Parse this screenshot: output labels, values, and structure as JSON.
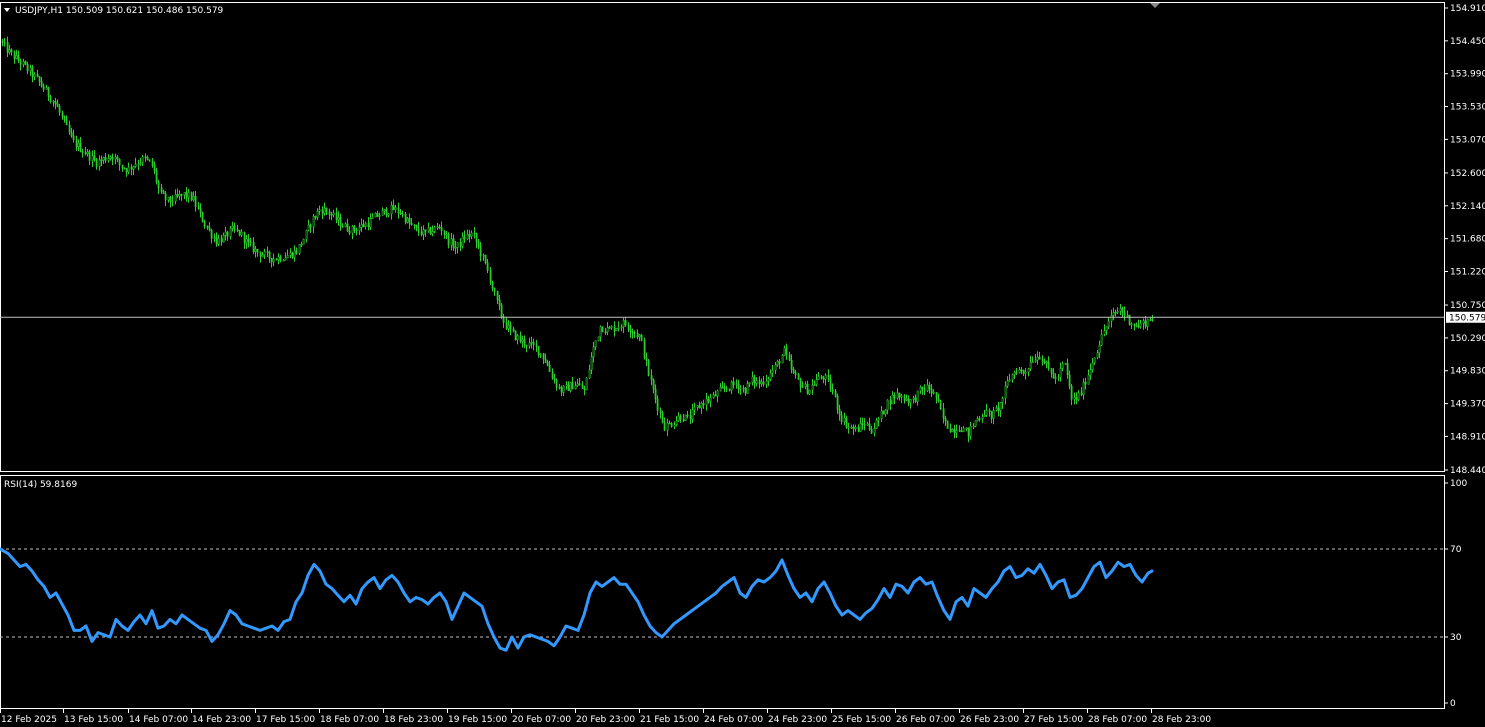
{
  "window": {
    "symbol_info": "USDJPY,H1  150.509 150.621 150.486 150.579"
  },
  "indicator": {
    "label": "RSI(14) 59.8169"
  },
  "current_price_label": "150.579",
  "colors": {
    "background": "#000000",
    "candle": "#2ecc2e",
    "rsi_line": "#3399ff",
    "grid_line": "#c0c0c0",
    "text": "#ffffff"
  },
  "chart_data": [
    {
      "type": "candlestick",
      "symbol": "USDJPY",
      "timeframe": "H1",
      "ohlc_last": {
        "open": 150.509,
        "high": 150.621,
        "low": 150.486,
        "close": 150.579
      },
      "current_price": 150.579,
      "y_ticks": [
        "154.910",
        "154.450",
        "153.990",
        "153.530",
        "153.070",
        "152.600",
        "152.140",
        "151.680",
        "151.220",
        "150.750",
        "150.290",
        "149.830",
        "149.370",
        "148.910",
        "148.440"
      ],
      "ylim": [
        148.44,
        154.91
      ],
      "x_ticks": [
        "12 Feb 2025",
        "13 Feb 15:00",
        "14 Feb 07:00",
        "14 Feb 23:00",
        "17 Feb 15:00",
        "18 Feb 07:00",
        "18 Feb 23:00",
        "19 Feb 15:00",
        "20 Feb 07:00",
        "20 Feb 23:00",
        "21 Feb 15:00",
        "24 Feb 07:00",
        "24 Feb 23:00",
        "25 Feb 15:00",
        "26 Feb 07:00",
        "26 Feb 23:00",
        "27 Feb 15:00",
        "28 Feb 07:00",
        "28 Feb 23:00"
      ],
      "close_profile": [
        [
          0,
          154.45
        ],
        [
          8,
          154.3
        ],
        [
          16,
          154.2
        ],
        [
          24,
          154.1
        ],
        [
          32,
          153.98
        ],
        [
          40,
          153.85
        ],
        [
          48,
          153.7
        ],
        [
          56,
          153.55
        ],
        [
          64,
          153.3
        ],
        [
          72,
          153.05
        ],
        [
          80,
          152.95
        ],
        [
          88,
          152.85
        ],
        [
          96,
          152.75
        ],
        [
          104,
          152.8
        ],
        [
          112,
          152.85
        ],
        [
          120,
          152.7
        ],
        [
          128,
          152.65
        ],
        [
          136,
          152.75
        ],
        [
          144,
          152.8
        ],
        [
          152,
          152.7
        ],
        [
          160,
          152.3
        ],
        [
          168,
          152.2
        ],
        [
          176,
          152.25
        ],
        [
          184,
          152.3
        ],
        [
          192,
          152.25
        ],
        [
          200,
          152.0
        ],
        [
          208,
          151.8
        ],
        [
          216,
          151.65
        ],
        [
          224,
          151.7
        ],
        [
          232,
          151.8
        ],
        [
          240,
          151.75
        ],
        [
          248,
          151.6
        ],
        [
          256,
          151.5
        ],
        [
          264,
          151.45
        ],
        [
          272,
          151.4
        ],
        [
          280,
          151.42
        ],
        [
          288,
          151.45
        ],
        [
          296,
          151.5
        ],
        [
          304,
          151.7
        ],
        [
          312,
          151.95
        ],
        [
          320,
          152.1
        ],
        [
          328,
          152.05
        ],
        [
          336,
          151.95
        ],
        [
          344,
          151.85
        ],
        [
          352,
          151.8
        ],
        [
          360,
          151.85
        ],
        [
          368,
          151.9
        ],
        [
          376,
          152.0
        ],
        [
          384,
          152.05
        ],
        [
          392,
          152.1
        ],
        [
          400,
          152.05
        ],
        [
          408,
          151.9
        ],
        [
          416,
          151.8
        ],
        [
          424,
          151.75
        ],
        [
          432,
          151.8
        ],
        [
          440,
          151.85
        ],
        [
          448,
          151.65
        ],
        [
          456,
          151.55
        ],
        [
          464,
          151.7
        ],
        [
          472,
          151.75
        ],
        [
          480,
          151.5
        ],
        [
          488,
          151.2
        ],
        [
          496,
          150.8
        ],
        [
          504,
          150.5
        ],
        [
          512,
          150.35
        ],
        [
          520,
          150.25
        ],
        [
          528,
          150.2
        ],
        [
          536,
          150.15
        ],
        [
          544,
          150.0
        ],
        [
          552,
          149.75
        ],
        [
          560,
          149.55
        ],
        [
          568,
          149.6
        ],
        [
          576,
          149.65
        ],
        [
          584,
          149.55
        ],
        [
          592,
          150.1
        ],
        [
          600,
          150.45
        ],
        [
          608,
          150.4
        ],
        [
          616,
          150.45
        ],
        [
          624,
          150.5
        ],
        [
          632,
          150.4
        ],
        [
          640,
          150.3
        ],
        [
          648,
          149.8
        ],
        [
          656,
          149.4
        ],
        [
          664,
          149.05
        ],
        [
          672,
          149.1
        ],
        [
          680,
          149.2
        ],
        [
          688,
          149.15
        ],
        [
          696,
          149.3
        ],
        [
          704,
          149.4
        ],
        [
          712,
          149.45
        ],
        [
          720,
          149.55
        ],
        [
          728,
          149.6
        ],
        [
          736,
          149.65
        ],
        [
          744,
          149.55
        ],
        [
          752,
          149.7
        ],
        [
          760,
          149.65
        ],
        [
          768,
          149.75
        ],
        [
          776,
          149.9
        ],
        [
          784,
          150.1
        ],
        [
          792,
          149.8
        ],
        [
          800,
          149.65
        ],
        [
          808,
          149.55
        ],
        [
          816,
          149.7
        ],
        [
          824,
          149.75
        ],
        [
          832,
          149.55
        ],
        [
          840,
          149.2
        ],
        [
          848,
          149.05
        ],
        [
          856,
          149.0
        ],
        [
          864,
          149.1
        ],
        [
          872,
          149.0
        ],
        [
          880,
          149.2
        ],
        [
          888,
          149.4
        ],
        [
          896,
          149.5
        ],
        [
          904,
          149.45
        ],
        [
          912,
          149.4
        ],
        [
          920,
          149.55
        ],
        [
          928,
          149.6
        ],
        [
          936,
          149.45
        ],
        [
          944,
          149.1
        ],
        [
          952,
          149.0
        ],
        [
          960,
          149.05
        ],
        [
          968,
          148.95
        ],
        [
          976,
          149.15
        ],
        [
          984,
          149.25
        ],
        [
          992,
          149.2
        ],
        [
          1000,
          149.35
        ],
        [
          1008,
          149.7
        ],
        [
          1016,
          149.85
        ],
        [
          1024,
          149.8
        ],
        [
          1032,
          150.0
        ],
        [
          1040,
          150.05
        ],
        [
          1048,
          149.85
        ],
        [
          1056,
          149.7
        ],
        [
          1064,
          149.95
        ],
        [
          1072,
          149.4
        ],
        [
          1080,
          149.5
        ],
        [
          1088,
          149.8
        ],
        [
          1096,
          150.1
        ],
        [
          1104,
          150.4
        ],
        [
          1112,
          150.6
        ],
        [
          1120,
          150.7
        ],
        [
          1128,
          150.55
        ],
        [
          1136,
          150.45
        ],
        [
          1144,
          150.5
        ],
        [
          1152,
          150.58
        ]
      ]
    },
    {
      "type": "line",
      "name": "RSI(14)",
      "value_last": 59.8169,
      "ylim": [
        0,
        100
      ],
      "y_ticks": [
        "100",
        "70",
        "30",
        "0"
      ],
      "levels": [
        70,
        30
      ],
      "profile": [
        [
          0,
          70
        ],
        [
          8,
          68
        ],
        [
          14,
          65
        ],
        [
          20,
          62
        ],
        [
          26,
          63
        ],
        [
          32,
          60
        ],
        [
          38,
          56
        ],
        [
          44,
          53
        ],
        [
          50,
          48
        ],
        [
          56,
          50
        ],
        [
          62,
          45
        ],
        [
          68,
          40
        ],
        [
          74,
          33
        ],
        [
          80,
          33
        ],
        [
          86,
          35
        ],
        [
          92,
          28
        ],
        [
          98,
          32
        ],
        [
          104,
          31
        ],
        [
          110,
          30
        ],
        [
          116,
          38
        ],
        [
          122,
          35
        ],
        [
          128,
          33
        ],
        [
          134,
          37
        ],
        [
          140,
          40
        ],
        [
          146,
          36
        ],
        [
          152,
          42
        ],
        [
          158,
          34
        ],
        [
          164,
          35
        ],
        [
          170,
          38
        ],
        [
          176,
          36
        ],
        [
          182,
          40
        ],
        [
          188,
          38
        ],
        [
          194,
          36
        ],
        [
          200,
          34
        ],
        [
          206,
          33
        ],
        [
          212,
          28
        ],
        [
          218,
          31
        ],
        [
          224,
          36
        ],
        [
          230,
          42
        ],
        [
          236,
          40
        ],
        [
          242,
          36
        ],
        [
          248,
          35
        ],
        [
          254,
          34
        ],
        [
          260,
          33
        ],
        [
          266,
          34
        ],
        [
          272,
          35
        ],
        [
          278,
          33
        ],
        [
          284,
          37
        ],
        [
          290,
          38
        ],
        [
          296,
          46
        ],
        [
          302,
          50
        ],
        [
          308,
          58
        ],
        [
          314,
          63
        ],
        [
          320,
          60
        ],
        [
          326,
          54
        ],
        [
          332,
          52
        ],
        [
          338,
          49
        ],
        [
          344,
          46
        ],
        [
          350,
          49
        ],
        [
          356,
          45
        ],
        [
          362,
          52
        ],
        [
          368,
          55
        ],
        [
          374,
          57
        ],
        [
          380,
          52
        ],
        [
          386,
          56
        ],
        [
          392,
          58
        ],
        [
          398,
          55
        ],
        [
          404,
          50
        ],
        [
          410,
          46
        ],
        [
          416,
          48
        ],
        [
          422,
          47
        ],
        [
          428,
          45
        ],
        [
          434,
          48
        ],
        [
          440,
          50
        ],
        [
          446,
          46
        ],
        [
          452,
          38
        ],
        [
          458,
          44
        ],
        [
          464,
          50
        ],
        [
          470,
          48
        ],
        [
          476,
          46
        ],
        [
          482,
          44
        ],
        [
          488,
          36
        ],
        [
          494,
          30
        ],
        [
          500,
          25
        ],
        [
          506,
          24
        ],
        [
          512,
          30
        ],
        [
          518,
          25
        ],
        [
          524,
          30
        ],
        [
          530,
          31
        ],
        [
          536,
          30
        ],
        [
          542,
          29
        ],
        [
          548,
          28
        ],
        [
          554,
          26
        ],
        [
          560,
          30
        ],
        [
          566,
          35
        ],
        [
          572,
          34
        ],
        [
          578,
          33
        ],
        [
          584,
          40
        ],
        [
          590,
          50
        ],
        [
          596,
          55
        ],
        [
          602,
          53
        ],
        [
          608,
          55
        ],
        [
          614,
          57
        ],
        [
          620,
          54
        ],
        [
          626,
          54
        ],
        [
          632,
          50
        ],
        [
          638,
          46
        ],
        [
          644,
          40
        ],
        [
          650,
          35
        ],
        [
          656,
          32
        ],
        [
          662,
          30
        ],
        [
          668,
          33
        ],
        [
          674,
          36
        ],
        [
          680,
          38
        ],
        [
          686,
          40
        ],
        [
          692,
          42
        ],
        [
          698,
          44
        ],
        [
          704,
          46
        ],
        [
          710,
          48
        ],
        [
          716,
          50
        ],
        [
          722,
          53
        ],
        [
          728,
          55
        ],
        [
          734,
          57
        ],
        [
          740,
          50
        ],
        [
          746,
          48
        ],
        [
          752,
          53
        ],
        [
          758,
          56
        ],
        [
          764,
          55
        ],
        [
          770,
          57
        ],
        [
          776,
          60
        ],
        [
          782,
          65
        ],
        [
          788,
          58
        ],
        [
          794,
          52
        ],
        [
          800,
          48
        ],
        [
          806,
          50
        ],
        [
          812,
          46
        ],
        [
          818,
          52
        ],
        [
          824,
          55
        ],
        [
          830,
          50
        ],
        [
          836,
          44
        ],
        [
          842,
          40
        ],
        [
          848,
          42
        ],
        [
          854,
          40
        ],
        [
          860,
          38
        ],
        [
          866,
          41
        ],
        [
          872,
          43
        ],
        [
          878,
          47
        ],
        [
          884,
          52
        ],
        [
          890,
          48
        ],
        [
          896,
          54
        ],
        [
          902,
          53
        ],
        [
          908,
          50
        ],
        [
          914,
          55
        ],
        [
          920,
          57
        ],
        [
          926,
          54
        ],
        [
          932,
          55
        ],
        [
          938,
          48
        ],
        [
          944,
          42
        ],
        [
          950,
          38
        ],
        [
          956,
          46
        ],
        [
          962,
          48
        ],
        [
          968,
          44
        ],
        [
          974,
          52
        ],
        [
          980,
          50
        ],
        [
          986,
          48
        ],
        [
          992,
          52
        ],
        [
          998,
          55
        ],
        [
          1004,
          60
        ],
        [
          1010,
          62
        ],
        [
          1016,
          57
        ],
        [
          1022,
          58
        ],
        [
          1028,
          61
        ],
        [
          1034,
          59
        ],
        [
          1040,
          63
        ],
        [
          1046,
          58
        ],
        [
          1052,
          52
        ],
        [
          1058,
          55
        ],
        [
          1064,
          56
        ],
        [
          1070,
          48
        ],
        [
          1076,
          49
        ],
        [
          1082,
          52
        ],
        [
          1088,
          57
        ],
        [
          1094,
          62
        ],
        [
          1100,
          64
        ],
        [
          1106,
          57
        ],
        [
          1112,
          60
        ],
        [
          1118,
          64
        ],
        [
          1124,
          62
        ],
        [
          1130,
          63
        ],
        [
          1136,
          58
        ],
        [
          1142,
          55
        ],
        [
          1148,
          59
        ],
        [
          1152,
          60
        ]
      ]
    }
  ]
}
